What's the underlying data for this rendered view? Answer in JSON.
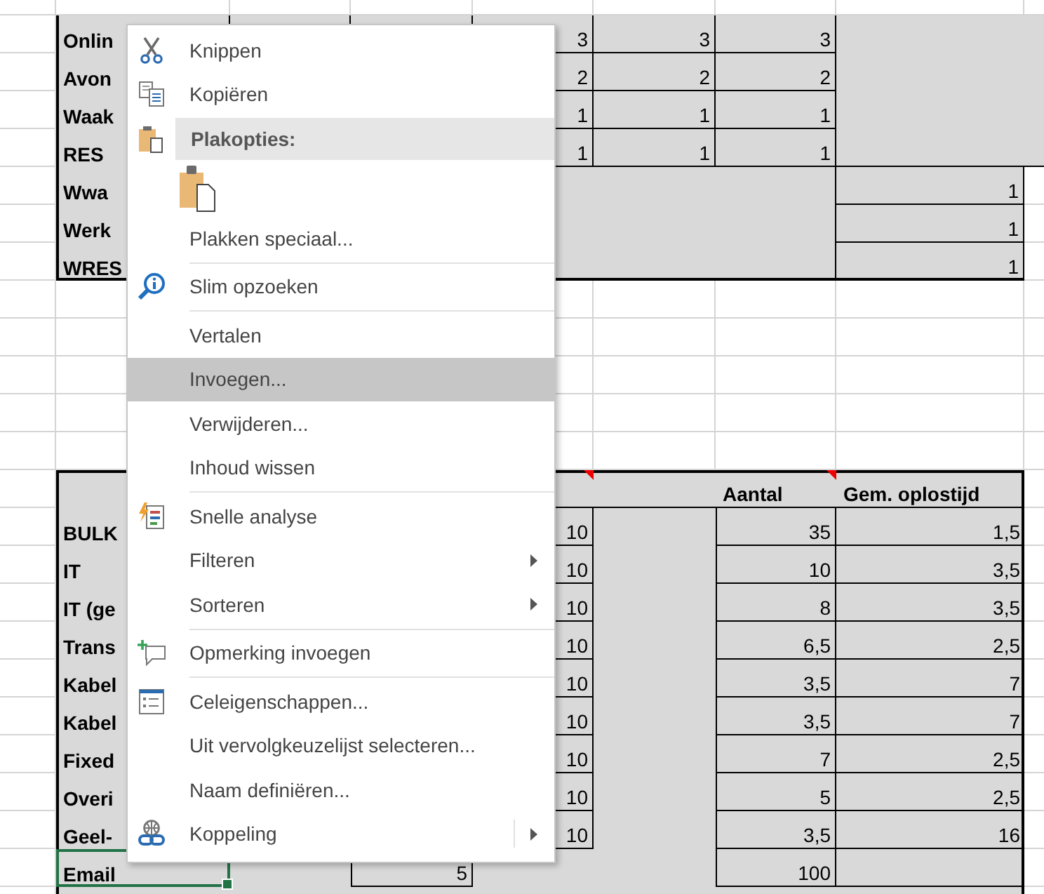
{
  "upper_table": {
    "rows": [
      {
        "label": "Onlin",
        "values": [
          "3",
          "3",
          "3"
        ]
      },
      {
        "label": "Avon",
        "values": [
          "2",
          "2",
          "2"
        ]
      },
      {
        "label": "Waak",
        "values": [
          "1",
          "1",
          "1"
        ]
      },
      {
        "label": "RES",
        "values": [
          "1",
          "1",
          "1"
        ]
      }
    ],
    "side_rows": [
      {
        "label": "Wwa",
        "value": "1"
      },
      {
        "label": "Werk",
        "value": "1"
      },
      {
        "label": "WRES",
        "value": "1"
      }
    ]
  },
  "lower_table": {
    "header": [
      {
        "has_comment": true
      },
      {
        "has_comment": false
      },
      {
        "text": "Aantal",
        "has_comment": true
      },
      {
        "text": "Gem. oplostijd",
        "has_comment": false
      }
    ],
    "rows": [
      {
        "label": "BULK",
        "column_4": "10",
        "aantal": "35",
        "gem_oplostijd": "1,5",
        "selected": false
      },
      {
        "label": "IT",
        "column_4": "10",
        "aantal": "10",
        "gem_oplostijd": "3,5",
        "selected": false
      },
      {
        "label": "IT (ge",
        "column_4": "10",
        "aantal": "8",
        "gem_oplostijd": "3,5",
        "selected": false
      },
      {
        "label": "Trans",
        "column_4": "10",
        "aantal": "6,5",
        "gem_oplostijd": "2,5",
        "selected": false
      },
      {
        "label": "Kabel",
        "column_4": "10",
        "aantal": "3,5",
        "gem_oplostijd": "7",
        "selected": false
      },
      {
        "label": "Kabel",
        "column_4": "10",
        "aantal": "3,5",
        "gem_oplostijd": "7",
        "selected": false
      },
      {
        "label": "Fixed",
        "column_4": "10",
        "aantal": "7",
        "gem_oplostijd": "2,5",
        "selected": false
      },
      {
        "label": "Overi",
        "column_4": "10",
        "aantal": "5",
        "gem_oplostijd": "2,5",
        "selected": false
      },
      {
        "label": "Geel-",
        "column_4": "10",
        "aantal": "3,5",
        "gem_oplostijd": "16",
        "selected": false
      },
      {
        "label": "Email",
        "column_3": "5",
        "aantal": "100",
        "selected": true
      }
    ]
  },
  "context_menu": {
    "items": [
      {
        "kind": "cut",
        "label": "Knippen",
        "submenu": false,
        "split": false,
        "selected": false
      },
      {
        "kind": "copy",
        "label": "Kopiëren",
        "submenu": false,
        "split": false,
        "selected": false
      },
      {
        "kind": "paste_header",
        "label": "Plakopties:"
      },
      {
        "kind": "paste_option"
      },
      {
        "kind": "plain",
        "label": "Plakken speciaal...",
        "submenu": false,
        "split": false,
        "selected": false
      },
      {
        "kind": "separator"
      },
      {
        "kind": "smart_lookup",
        "label": "Slim opzoeken",
        "submenu": false,
        "split": false,
        "selected": false
      },
      {
        "kind": "separator"
      },
      {
        "kind": "plain",
        "label": "Vertalen",
        "submenu": false,
        "split": false,
        "selected": false
      },
      {
        "kind": "plain",
        "label": "Invoegen...",
        "submenu": false,
        "split": false,
        "selected": true
      },
      {
        "kind": "plain",
        "label": "Verwijderen...",
        "submenu": false,
        "split": false,
        "selected": false
      },
      {
        "kind": "plain",
        "label": "Inhoud wissen",
        "submenu": false,
        "split": false,
        "selected": false
      },
      {
        "kind": "separator"
      },
      {
        "kind": "quick_analysis",
        "label": "Snelle analyse",
        "submenu": false,
        "split": false,
        "selected": false
      },
      {
        "kind": "plain",
        "label": "Filteren",
        "submenu": true,
        "split": false,
        "selected": false
      },
      {
        "kind": "plain",
        "label": "Sorteren",
        "submenu": true,
        "split": false,
        "selected": false
      },
      {
        "kind": "separator"
      },
      {
        "kind": "comment",
        "label": "Opmerking invoegen",
        "submenu": false,
        "split": false,
        "selected": false
      },
      {
        "kind": "separator"
      },
      {
        "kind": "format_cells",
        "label": "Celeigenschappen...",
        "submenu": false,
        "split": false,
        "selected": false
      },
      {
        "kind": "plain",
        "label": "Uit vervolgkeuzelijst selecteren...",
        "submenu": false,
        "split": false,
        "selected": false
      },
      {
        "kind": "plain",
        "label": "Naam definiëren...",
        "submenu": false,
        "split": false,
        "selected": false
      },
      {
        "kind": "link",
        "label": "Koppeling",
        "submenu": true,
        "split": true,
        "selected": false
      }
    ]
  }
}
